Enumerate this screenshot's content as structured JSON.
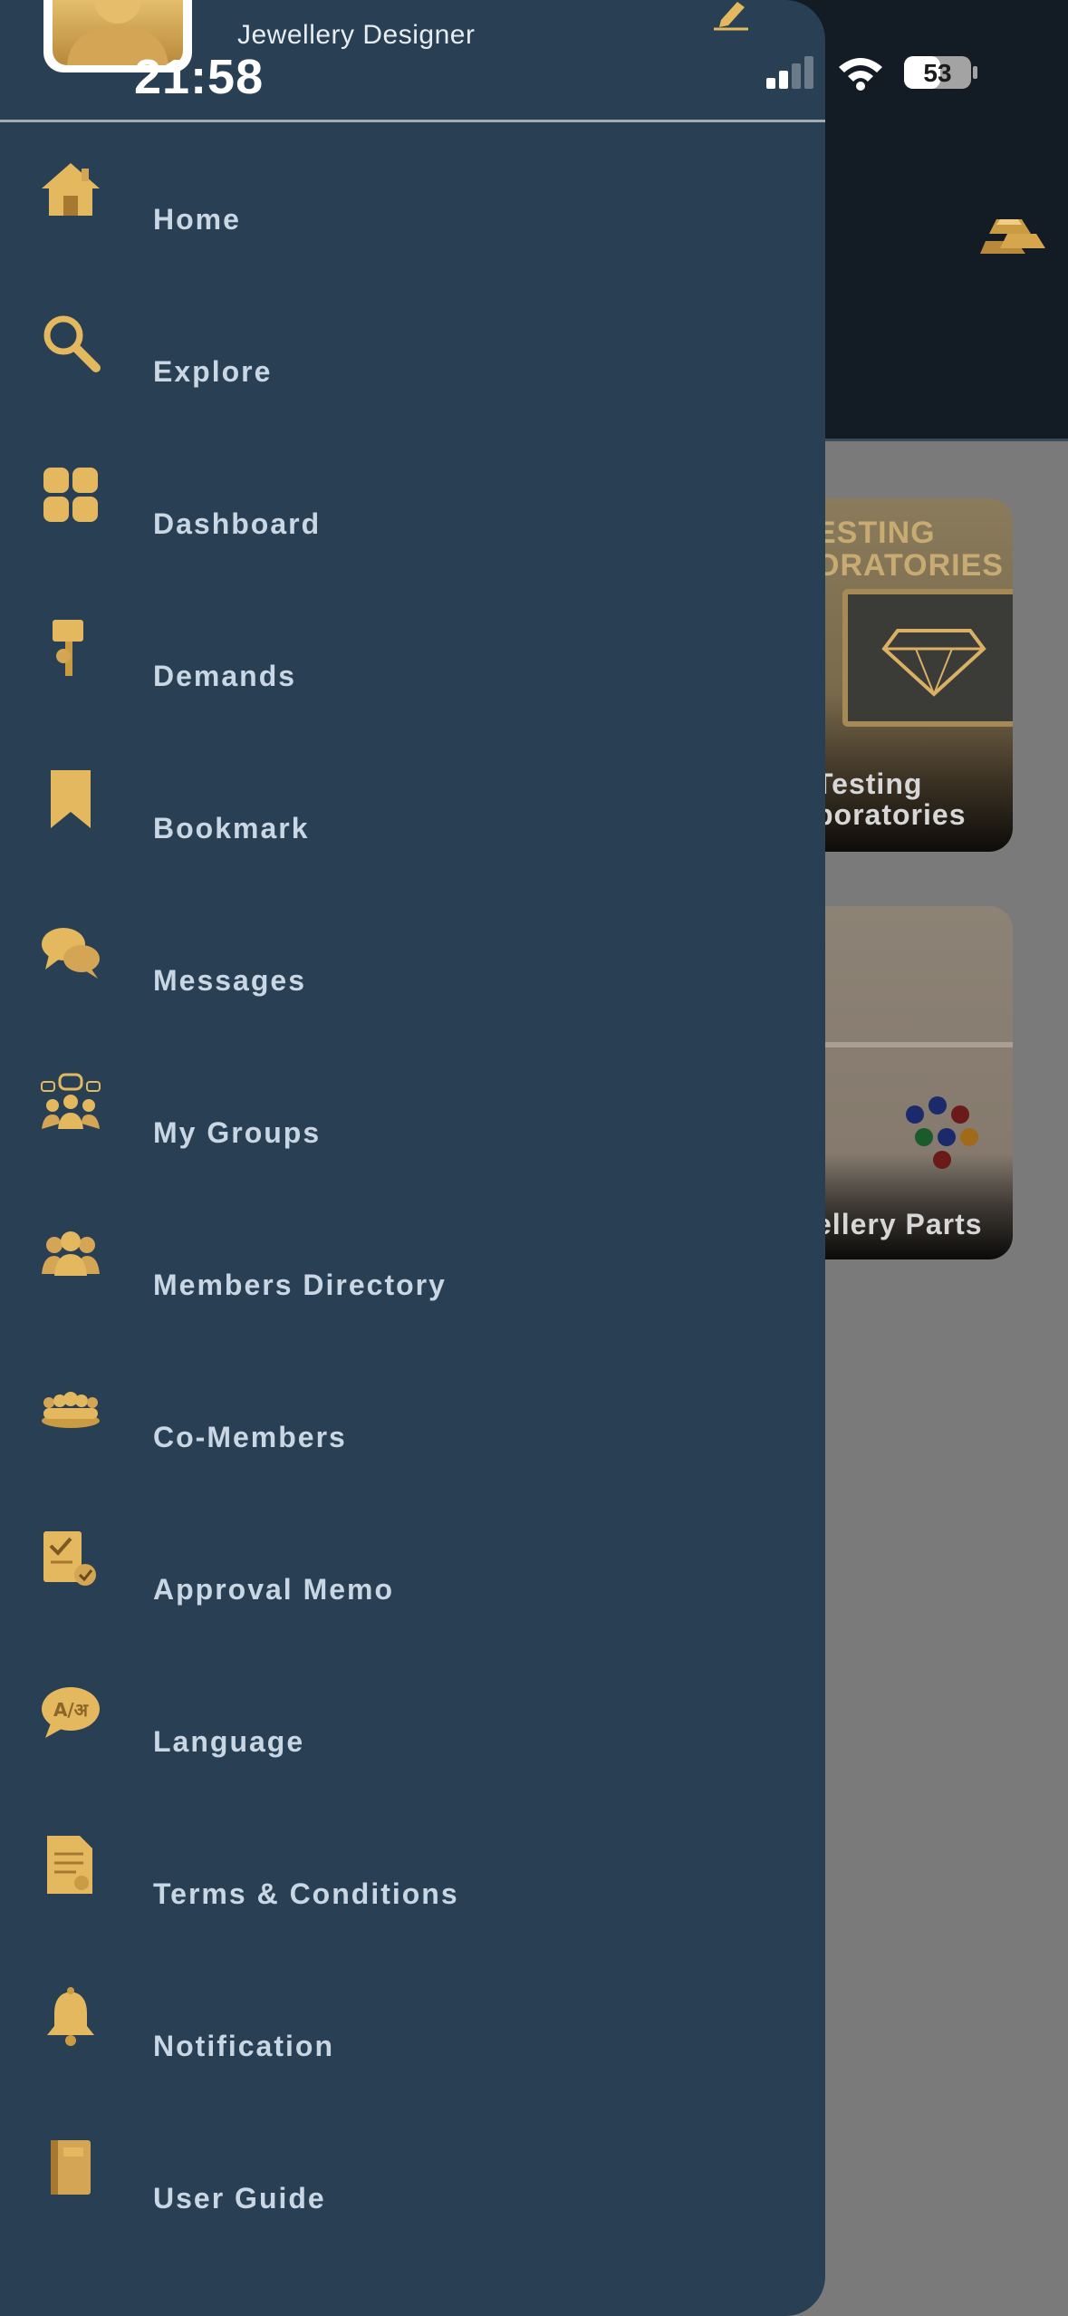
{
  "status_bar": {
    "time": "21:58",
    "battery_level": "53"
  },
  "drawer": {
    "profession": "Jewellery Designer",
    "menu": [
      {
        "label": "Home",
        "icon": "home-icon"
      },
      {
        "label": "Explore",
        "icon": "search-icon"
      },
      {
        "label": "Dashboard",
        "icon": "dashboard-icon"
      },
      {
        "label": "Demands",
        "icon": "demands-icon"
      },
      {
        "label": "Bookmark",
        "icon": "bookmark-icon"
      },
      {
        "label": "Messages",
        "icon": "messages-icon"
      },
      {
        "label": "My Groups",
        "icon": "groups-icon"
      },
      {
        "label": "Members Directory",
        "icon": "members-icon"
      },
      {
        "label": "Co-Members",
        "icon": "co-members-icon"
      },
      {
        "label": "Approval Memo",
        "icon": "approval-memo-icon"
      },
      {
        "label": "Language",
        "icon": "language-icon"
      },
      {
        "label": "Terms & Conditions",
        "icon": "terms-icon"
      },
      {
        "label": "Notification",
        "icon": "bell-icon"
      },
      {
        "label": "User Guide",
        "icon": "guide-book-icon"
      }
    ]
  },
  "background": {
    "cards": [
      {
        "header": "ESTING ORATORIES",
        "title_line1": "Testing",
        "title_line2": "boratories"
      },
      {
        "title": "ellery Parts"
      }
    ]
  },
  "colors": {
    "drawer_bg": "#283f54",
    "gold": "#e3b85e",
    "menu_text": "#c9d7e4"
  }
}
